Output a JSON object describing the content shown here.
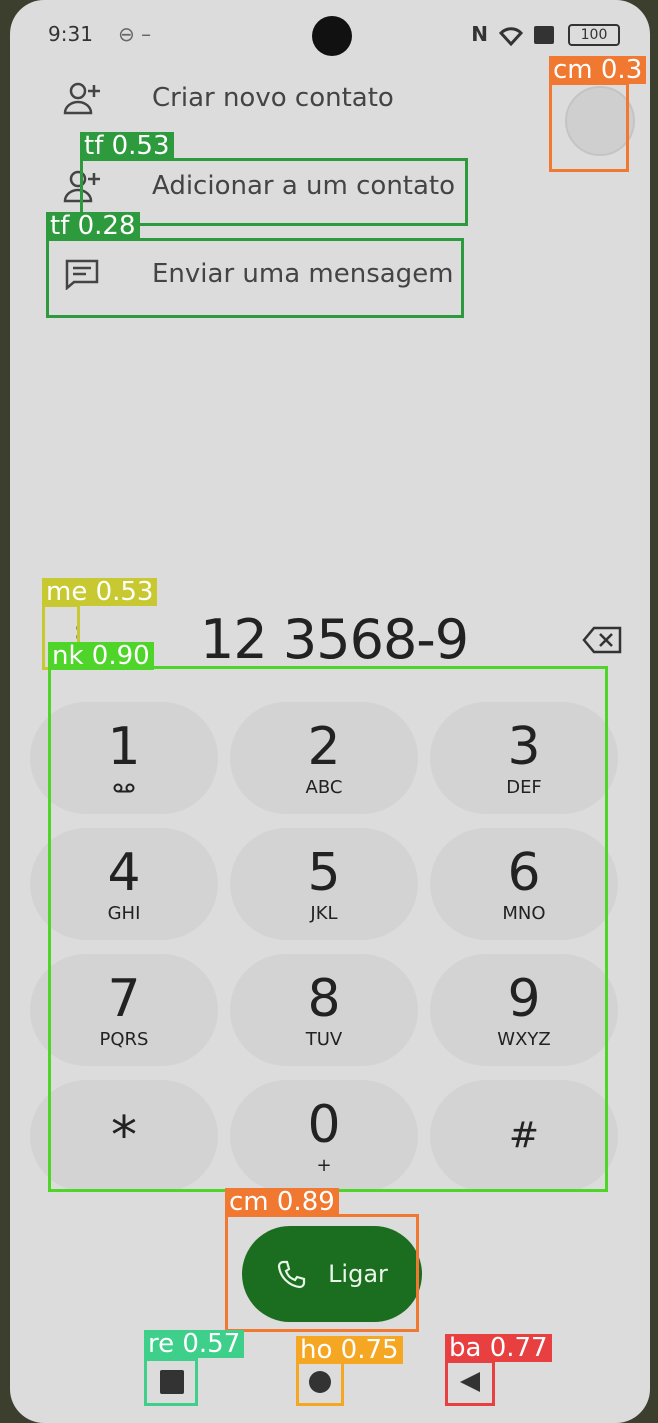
{
  "status_bar": {
    "time": "9:31",
    "extra": "⊖ –",
    "battery": "100"
  },
  "menu": [
    {
      "label": "Criar novo contato",
      "icon": "person-add-icon"
    },
    {
      "label": "Adicionar a um contato",
      "icon": "person-add-icon"
    },
    {
      "label": "Enviar uma mensagem",
      "icon": "message-icon"
    }
  ],
  "dialer": {
    "number": "12 3568-9",
    "more_icon": "⋮"
  },
  "keys": [
    {
      "digit": "1",
      "letters": "oo"
    },
    {
      "digit": "2",
      "letters": "ABC"
    },
    {
      "digit": "3",
      "letters": "DEF"
    },
    {
      "digit": "4",
      "letters": "GHI"
    },
    {
      "digit": "5",
      "letters": "JKL"
    },
    {
      "digit": "6",
      "letters": "MNO"
    },
    {
      "digit": "7",
      "letters": "PQRS"
    },
    {
      "digit": "8",
      "letters": "TUV"
    },
    {
      "digit": "9",
      "letters": "WXYZ"
    },
    {
      "digit": "*",
      "letters": ""
    },
    {
      "digit": "0",
      "letters": "+"
    },
    {
      "digit": "#",
      "letters": ""
    }
  ],
  "call_button": {
    "label": "Ligar"
  },
  "annotations": [
    {
      "tag": "cm 0.3",
      "color": "#f07830"
    },
    {
      "tag": "tf 0.53",
      "color": "#2e9a3e"
    },
    {
      "tag": "tf 0.28",
      "color": "#2e9a3e"
    },
    {
      "tag": "me 0.53",
      "color": "#c8c830"
    },
    {
      "tag": "nk 0.90",
      "color": "#4fd42a"
    },
    {
      "tag": "cm 0.89",
      "color": "#f07830"
    },
    {
      "tag": "re 0.57",
      "color": "#3ecf8a"
    },
    {
      "tag": "ho 0.75",
      "color": "#f5a623"
    },
    {
      "tag": "ba 0.77",
      "color": "#e84040"
    }
  ]
}
